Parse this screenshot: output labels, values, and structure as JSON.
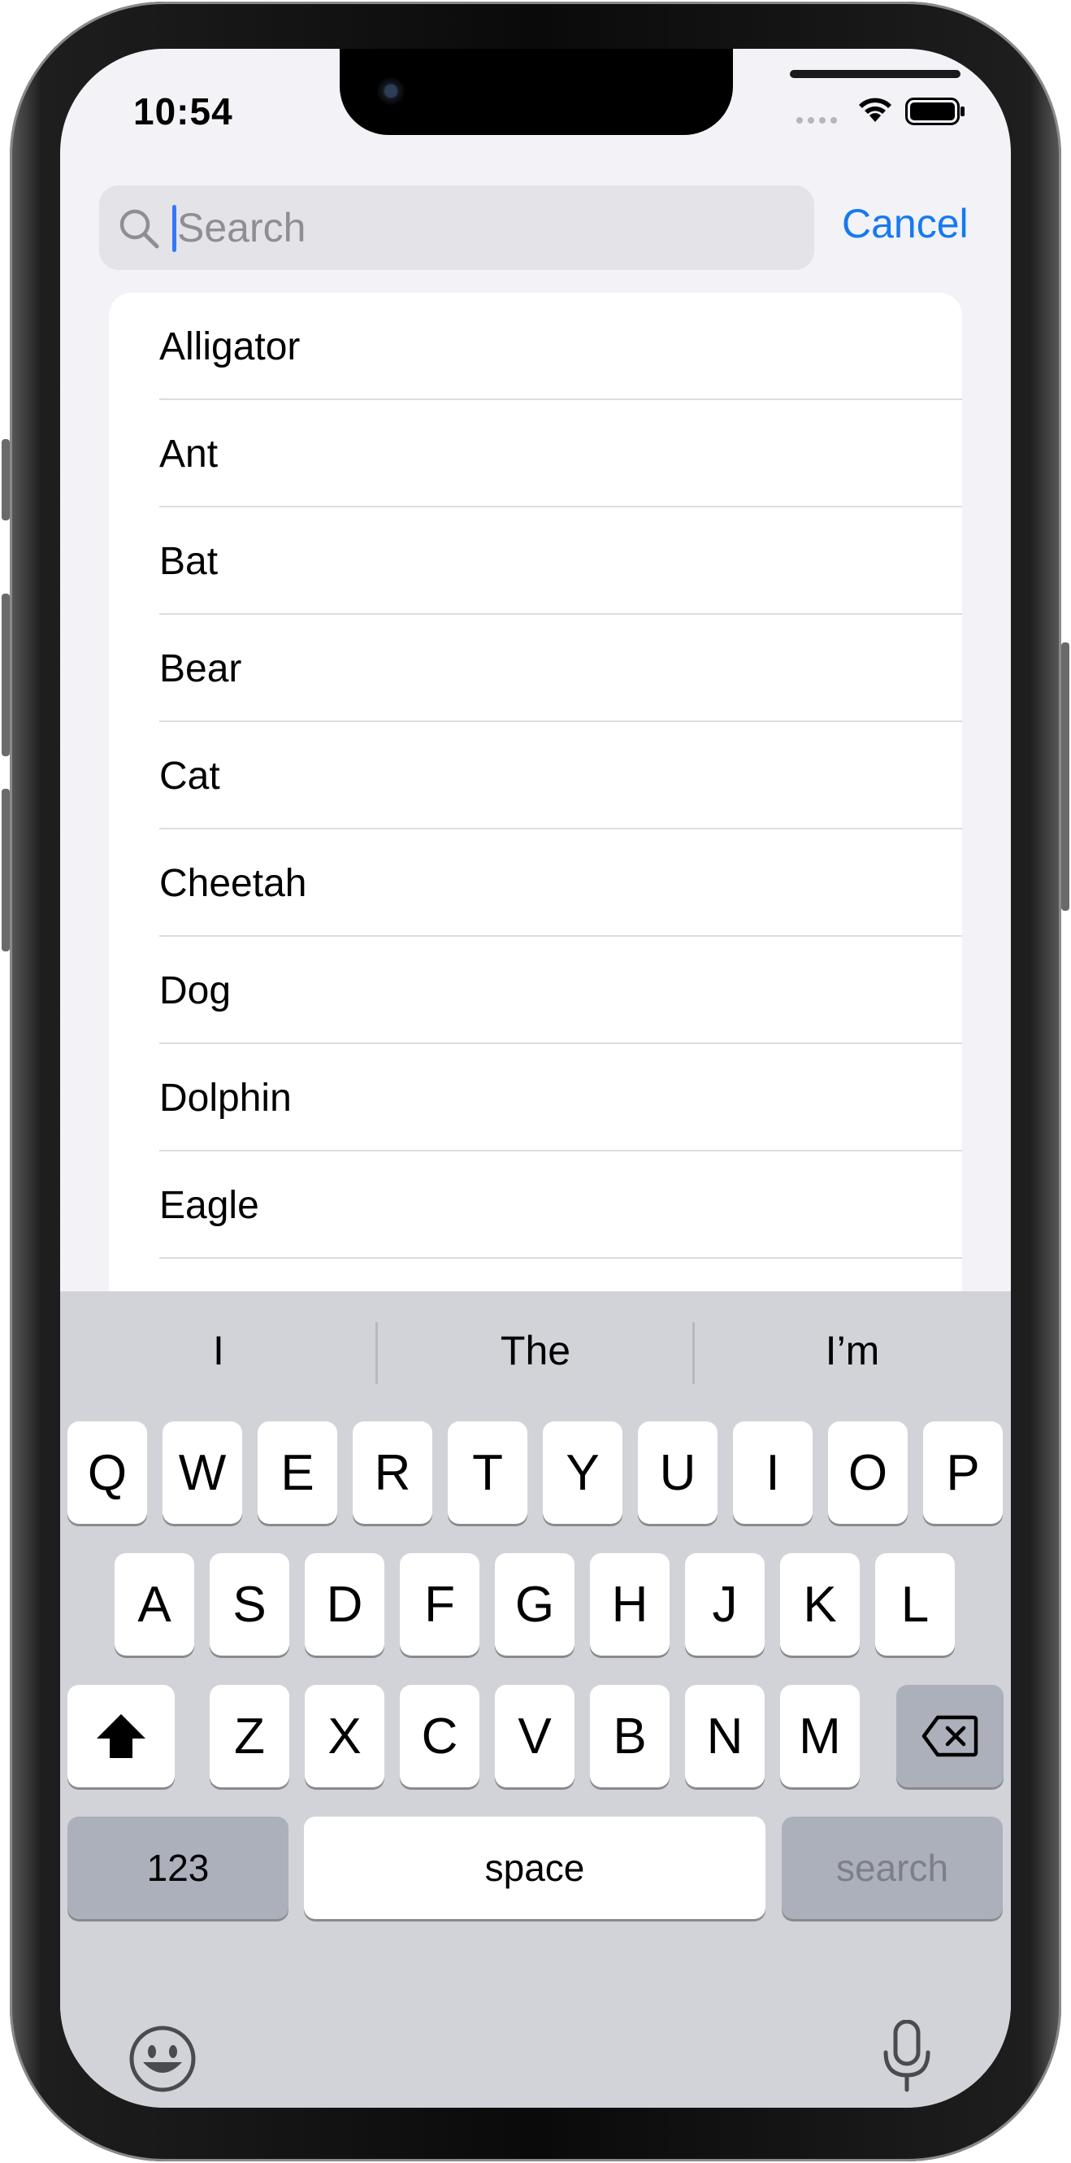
{
  "status_bar": {
    "time": "10:54"
  },
  "search": {
    "placeholder": "Search",
    "value": "",
    "cancel_label": "Cancel"
  },
  "list": {
    "items": [
      "Alligator",
      "Ant",
      "Bat",
      "Bear",
      "Cat",
      "Cheetah",
      "Dog",
      "Dolphin",
      "Eagle",
      ""
    ]
  },
  "keyboard": {
    "suggestions": [
      "I",
      "The",
      "I’m"
    ],
    "row1": [
      "Q",
      "W",
      "E",
      "R",
      "T",
      "Y",
      "U",
      "I",
      "O",
      "P"
    ],
    "row2": [
      "A",
      "S",
      "D",
      "F",
      "G",
      "H",
      "J",
      "K",
      "L"
    ],
    "row3": [
      "Z",
      "X",
      "C",
      "V",
      "B",
      "N",
      "M"
    ],
    "numbers_label": "123",
    "space_label": "space",
    "return_label": "search"
  },
  "colors": {
    "accent": "#1779ef",
    "background": "#f2f2f7",
    "keyboard": "#d1d3d9"
  },
  "icons": [
    "search-icon",
    "wifi-icon",
    "battery-icon",
    "shift-icon",
    "delete-icon",
    "emoji-icon",
    "microphone-icon"
  ]
}
